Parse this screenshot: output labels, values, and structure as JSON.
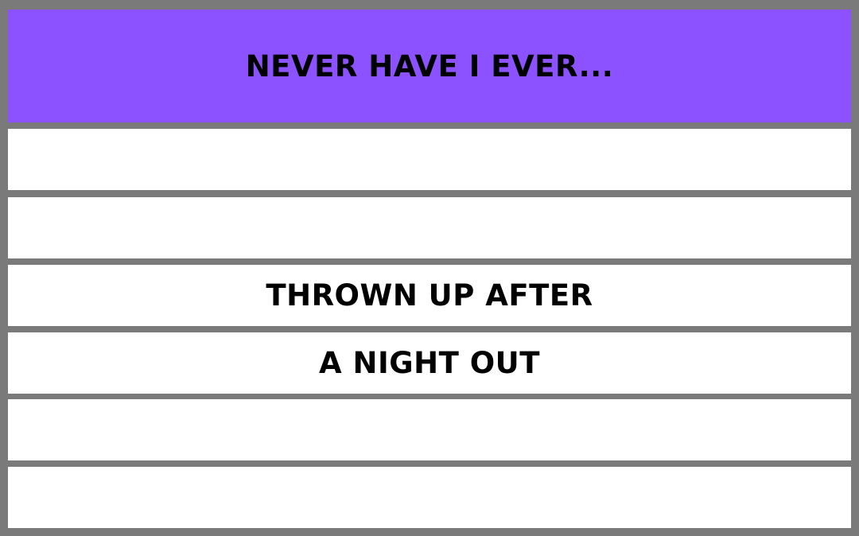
{
  "card": {
    "title": "NEVER HAVE I EVER...",
    "lines": [
      "",
      "",
      "THROWN UP AFTER",
      "A NIGHT OUT",
      "",
      ""
    ]
  },
  "colors": {
    "header": "#8c52ff",
    "frame": "#7a7a7a",
    "row": "#ffffff",
    "text": "#000000"
  }
}
